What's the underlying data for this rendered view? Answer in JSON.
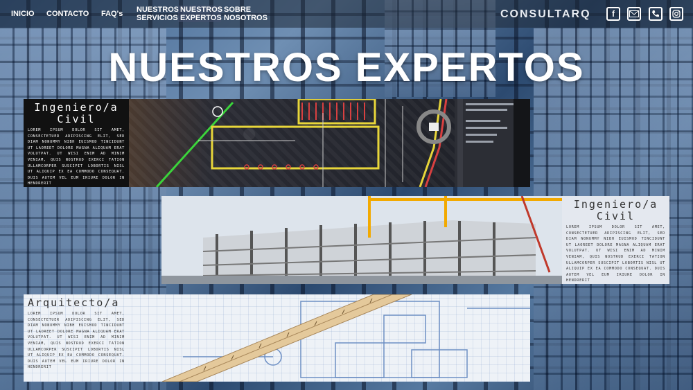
{
  "nav": {
    "inicio": "INICIO",
    "contacto": "CONTACTO",
    "faqs": "FAQ's",
    "servicios": "NUESTROS SERVICIOS",
    "expertos": "NUESTROS EXPERTOS",
    "nosotros": "SOBRE NOSOTROS"
  },
  "brand": "CONSULTARQ",
  "social": [
    "facebook-icon",
    "mail-icon",
    "phone-icon",
    "instagram-icon"
  ],
  "hero_title": "NUESTROS EXPERTOS",
  "cards": [
    {
      "title": "Ingeniero/a Civil",
      "body": "Lorem ipsum dolor sit amet, consectetuer adipiscing elit, sed diam nonummy nibh euismod tincidunt ut laoreet dolore magna aliquam erat volutpat. Ut wisi enim ad minim veniam, quis nostrud exerci tation ullamcorper suscipit lobortis nisl ut aliquip ex ea commodo consequat. Duis autem vel eum iriure dolor in hendrerit"
    },
    {
      "title": "Ingeniero/a Civil",
      "body": "Lorem ipsum dolor sit amet, consectetuer adipiscing elit, sed diam nonummy nibh euismod tincidunt ut laoreet dolore magna aliquam erat volutpat. Ut wisi enim ad minim veniam, quis nostrud exerci tation ullamcorper suscipit lobortis nisl ut aliquip ex ea commodo consequat. Duis autem vel eum iriure dolor in hendrerit"
    },
    {
      "title": "Arquitecto/a",
      "body": "Lorem ipsum dolor sit amet, consectetuer adipiscing elit, sed diam nonummy nibh euismod tincidunt ut laoreet dolore magna aliquam erat volutpat. Ut wisi enim ad minim veniam, quis nostrud exerci tation ullamcorper suscipit lobortis nisl ut aliquip ex ea commodo consequat. Duis autem vel eum iriure dolor in hendrerit"
    }
  ]
}
